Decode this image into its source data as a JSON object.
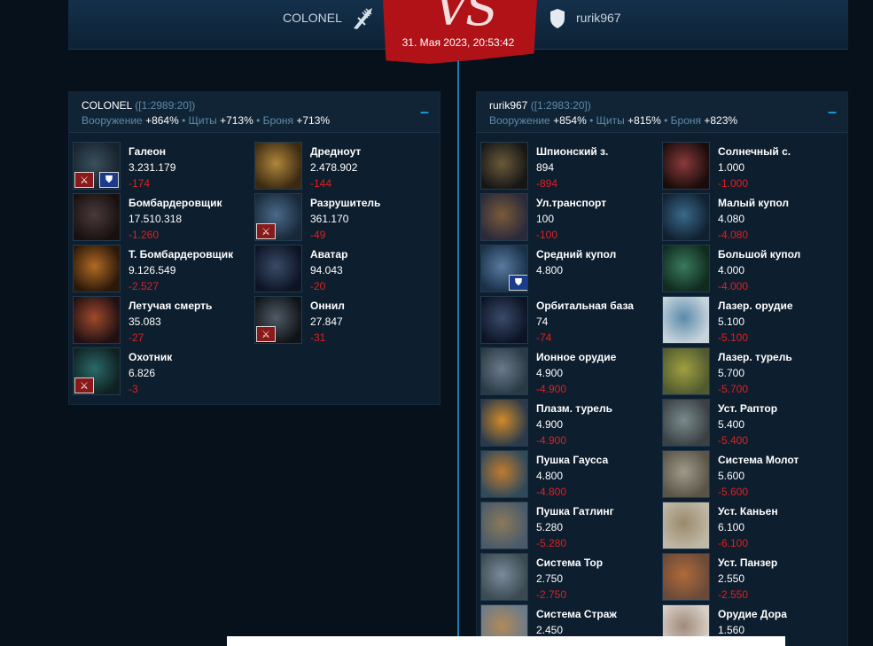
{
  "header": {
    "attacker": "COLONEL",
    "defender": "rurik967",
    "vs": "VS",
    "date": "31. Мая 2023, 20:53:42"
  },
  "left": {
    "name": "COLONEL",
    "coords": "([1:2989:20])",
    "weapons_label": "Вооружение",
    "weapons": "+864%",
    "shields_label": "Щиты",
    "shields": "+713%",
    "armor_label": "Броня",
    "armor": "+713%",
    "collapse": "–",
    "units": [
      {
        "name": "Галеон",
        "count": "3.231.179",
        "loss": "-174",
        "badges": [
          "red",
          "blue"
        ],
        "art": "galleon"
      },
      {
        "name": "Дредноут",
        "count": "2.478.902",
        "loss": "-144",
        "badges": [],
        "art": "dread"
      },
      {
        "name": "Бомбардеровщик",
        "count": "17.510.318",
        "loss": "-1.260",
        "badges": [],
        "art": "bomber"
      },
      {
        "name": "Разрушитель",
        "count": "361.170",
        "loss": "-49",
        "badges": [
          "red"
        ],
        "art": "destroyer"
      },
      {
        "name": "Т. Бомбардеровщик",
        "count": "9.126.549",
        "loss": "-2.527",
        "badges": [],
        "art": "hbomber"
      },
      {
        "name": "Аватар",
        "count": "94.043",
        "loss": "-20",
        "badges": [],
        "art": "avatar"
      },
      {
        "name": "Летучая смерть",
        "count": "35.083",
        "loss": "-27",
        "badges": [],
        "art": "death"
      },
      {
        "name": "Оннил",
        "count": "27.847",
        "loss": "-31",
        "badges": [
          "red"
        ],
        "art": "onnil"
      },
      {
        "name": "Охотник",
        "count": "6.826",
        "loss": "-3",
        "badges": [
          "red"
        ],
        "art": "hunter"
      }
    ]
  },
  "right": {
    "name": "rurik967",
    "coords": "([1:2983:20])",
    "weapons_label": "Вооружение",
    "weapons": "+854%",
    "shields_label": "Щиты",
    "shields": "+815%",
    "armor_label": "Броня",
    "armor": "+823%",
    "collapse": "–",
    "units": [
      {
        "name": "Шпионский з.",
        "count": "894",
        "loss": "-894",
        "badges": [],
        "art": "spy"
      },
      {
        "name": "Солнечный с.",
        "count": "1.000",
        "loss": "-1.000",
        "badges": [],
        "art": "solar"
      },
      {
        "name": "Ул.транспорт",
        "count": "100",
        "loss": "-100",
        "badges": [],
        "art": "transport"
      },
      {
        "name": "Малый купол",
        "count": "4.080",
        "loss": "-4.080",
        "badges": [],
        "art": "smalldome"
      },
      {
        "name": "Средний купол",
        "count": "4.800",
        "loss": "",
        "badges": [
          "blue"
        ],
        "art": "middome"
      },
      {
        "name": "Большой купол",
        "count": "4.000",
        "loss": "-4.000",
        "badges": [],
        "art": "bigdome"
      },
      {
        "name": "Орбитальная база",
        "count": "74",
        "loss": "-74",
        "badges": [],
        "art": "orbital"
      },
      {
        "name": "Лазер. орудие",
        "count": "5.100",
        "loss": "-5.100",
        "badges": [],
        "art": "lasergun"
      },
      {
        "name": "Ионное орудие",
        "count": "4.900",
        "loss": "-4.900",
        "badges": [],
        "art": "ion"
      },
      {
        "name": "Лазер. турель",
        "count": "5.700",
        "loss": "-5.700",
        "badges": [],
        "art": "laserturret"
      },
      {
        "name": "Плазм. турель",
        "count": "4.900",
        "loss": "-4.900",
        "badges": [],
        "art": "plasma"
      },
      {
        "name": "Уст. Раптор",
        "count": "5.400",
        "loss": "-5.400",
        "badges": [],
        "art": "raptor"
      },
      {
        "name": "Пушка Гаусса",
        "count": "4.800",
        "loss": "-4.800",
        "badges": [],
        "art": "gauss"
      },
      {
        "name": "Система Молот",
        "count": "5.600",
        "loss": "-5.600",
        "badges": [],
        "art": "hammer"
      },
      {
        "name": "Пушка Гатлинг",
        "count": "5.280",
        "loss": "-5.280",
        "badges": [],
        "art": "gatling"
      },
      {
        "name": "Уст. Каньен",
        "count": "6.100",
        "loss": "-6.100",
        "badges": [],
        "art": "canyon"
      },
      {
        "name": "Система Тор",
        "count": "2.750",
        "loss": "-2.750",
        "badges": [],
        "art": "thor"
      },
      {
        "name": "Уст. Панзер",
        "count": "2.550",
        "loss": "-2.550",
        "badges": [],
        "art": "panzer"
      },
      {
        "name": "Система Страж",
        "count": "2.450",
        "loss": "",
        "badges": [],
        "art": "guard"
      },
      {
        "name": "Орудие Дора",
        "count": "1.560",
        "loss": "",
        "badges": [],
        "art": "dora"
      }
    ]
  },
  "colors": {
    "accent": "#1a9be0",
    "loss": "#e02020",
    "banner": "#b01218"
  }
}
